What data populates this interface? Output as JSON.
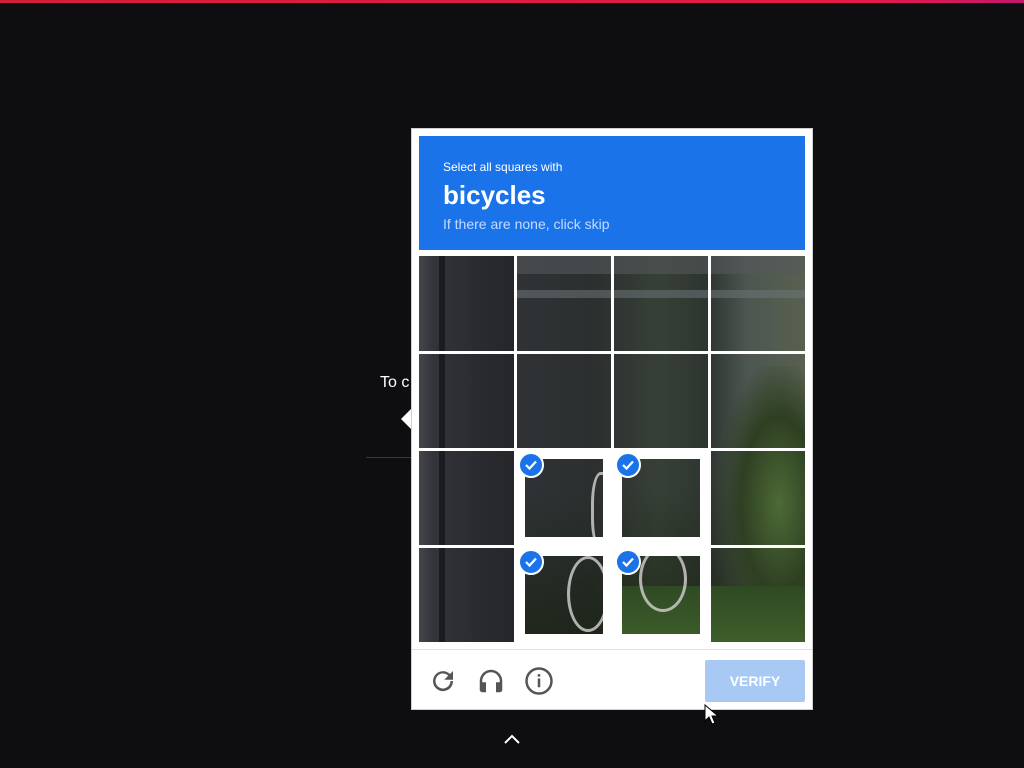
{
  "background": {
    "partial_text": "To c"
  },
  "captcha": {
    "instruction": "Select all squares with",
    "keyword": "bicycles",
    "hint": "If there are none, click skip",
    "header_color": "#1a73e8",
    "grid": {
      "rows": 4,
      "cols": 4,
      "selected": [
        {
          "row": 3,
          "col": 2
        },
        {
          "row": 3,
          "col": 3
        },
        {
          "row": 4,
          "col": 2
        },
        {
          "row": 4,
          "col": 3
        }
      ]
    },
    "footer": {
      "icons": [
        "reload-icon",
        "headphones-icon",
        "info-icon"
      ],
      "verify_label": "VERIFY",
      "verify_color": "#a9c9f5"
    }
  }
}
